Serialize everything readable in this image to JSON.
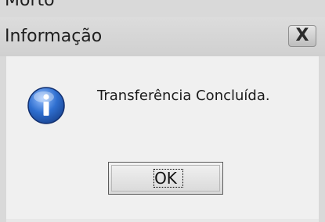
{
  "background_window": {
    "partial_title": "Morto"
  },
  "dialog": {
    "title": "Informação",
    "close_glyph": "X",
    "icon": "info-icon",
    "message": "Transferência Concluída.",
    "ok_label": "OK"
  },
  "colors": {
    "titlebar": "#d4d4d4",
    "client": "#f0f0f0",
    "icon_blue": "#2f6fd0"
  }
}
